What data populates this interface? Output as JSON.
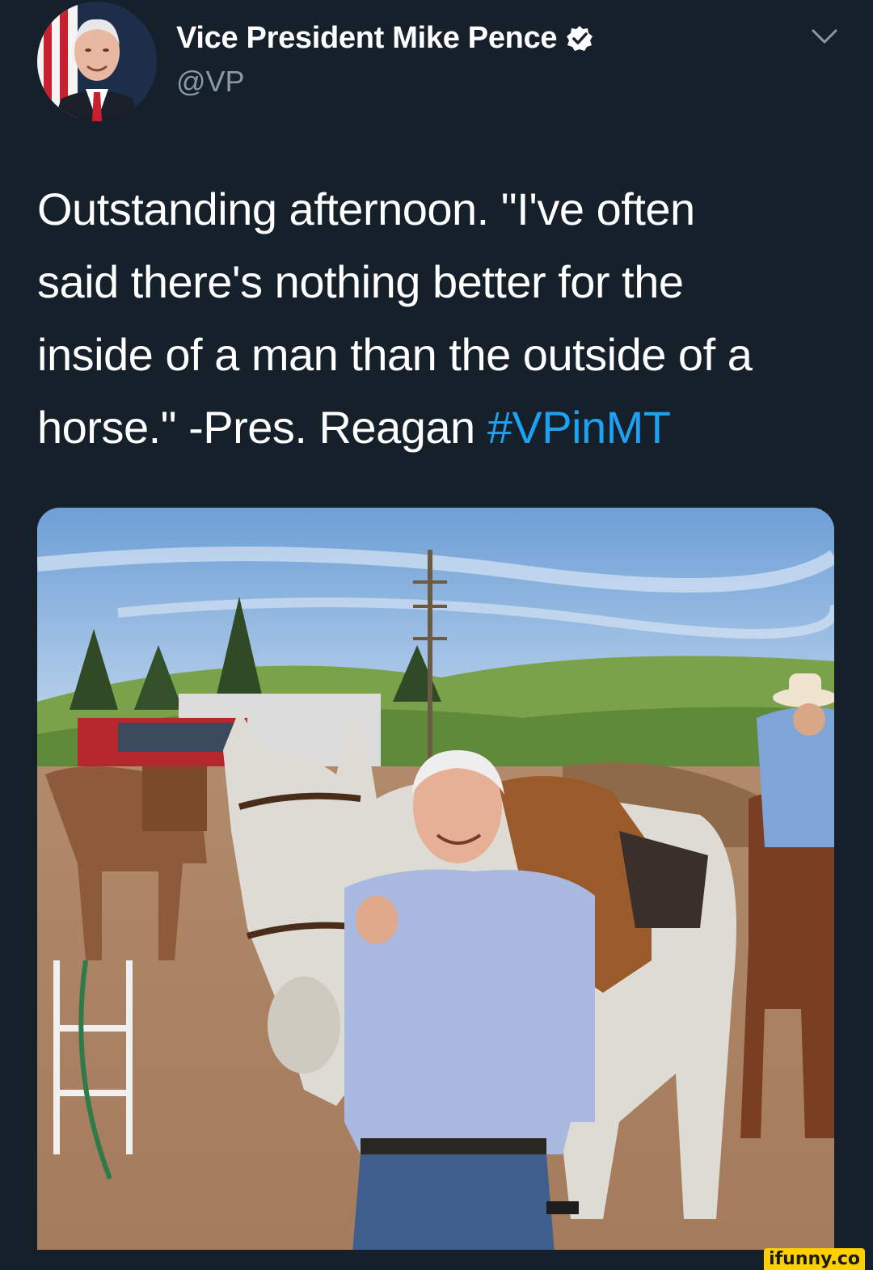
{
  "tweet": {
    "display_name": "Vice President Mike Pence",
    "handle": "@VP",
    "verified": true,
    "text_lines": [
      "Outstanding afternoon. \"I've often",
      "said there's nothing better for the",
      "inside of a man than the outside of a",
      "horse.\" -Pres. Reagan "
    ],
    "hashtag": "#VPinMT",
    "colors": {
      "background": "#15202b",
      "text": "#ffffff",
      "secondary_text": "#8899a6",
      "link": "#1da1f2"
    },
    "icons": {
      "verified": "verified-badge-icon",
      "menu": "chevron-down-icon"
    }
  },
  "watermark": {
    "text": "ifunny.co"
  }
}
